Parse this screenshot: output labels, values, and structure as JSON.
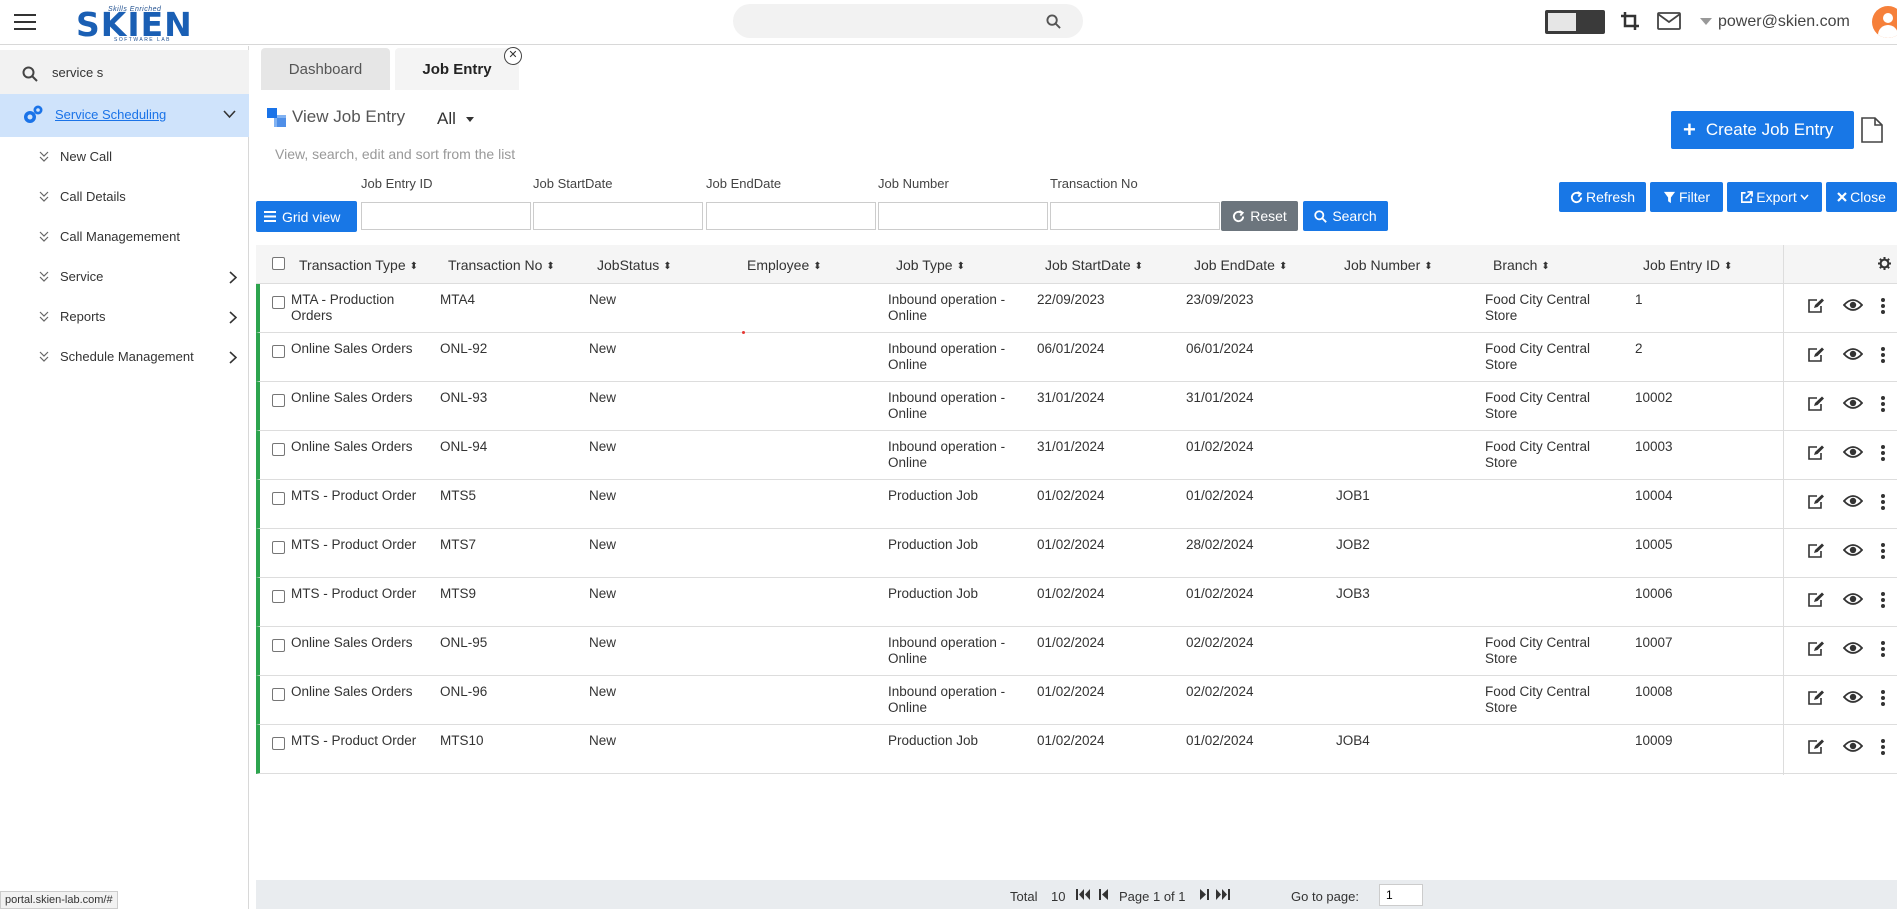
{
  "app": {
    "user_email": "power@skien.com",
    "status_url": "portal.skien-lab.com/#"
  },
  "logo": {
    "tagline": "Skills Enriched",
    "word": "SKIEN",
    "sub": "SOFTWARE LAB"
  },
  "sidebar": {
    "search_value": "service s",
    "active": "Service Scheduling",
    "items": [
      {
        "label": "New Call"
      },
      {
        "label": "Call Details"
      },
      {
        "label": "Call Managemement"
      },
      {
        "label": "Service"
      },
      {
        "label": "Reports"
      },
      {
        "label": "Schedule Management"
      }
    ]
  },
  "tabs": [
    {
      "label": "Dashboard"
    },
    {
      "label": "Job Entry"
    }
  ],
  "page": {
    "title": "View Job Entry",
    "filter": "All",
    "subtitle": "View, search, edit and sort from the list",
    "create_label": "Create Job Entry"
  },
  "filters": {
    "grid_view": "Grid view",
    "labels": [
      "Job Entry ID",
      "Job StartDate",
      "Job EndDate",
      "Job Number",
      "Transaction No"
    ],
    "reset": "Reset",
    "search": "Search"
  },
  "actions": {
    "refresh": "Refresh",
    "filter": "Filter",
    "export": "Export",
    "close": "Close"
  },
  "table": {
    "columns": [
      "Transaction Type",
      "Transaction No",
      "JobStatus",
      "Employee",
      "Job Type",
      "Job StartDate",
      "Job EndDate",
      "Job Number",
      "Branch",
      "Job Entry ID"
    ],
    "rows": [
      {
        "type": "MTA - Production Orders",
        "txn": "MTA4",
        "status": "New",
        "employee": "",
        "job_type": "Inbound operation - Online",
        "start": "22/09/2023",
        "end": "23/09/2023",
        "job_no": "",
        "branch": "Food City Central Store",
        "id": "1"
      },
      {
        "type": "Online Sales Orders",
        "txn": "ONL-92",
        "status": "New",
        "employee": "",
        "job_type": "Inbound operation - Online",
        "start": "06/01/2024",
        "end": "06/01/2024",
        "job_no": "",
        "branch": "Food City Central Store",
        "id": "2"
      },
      {
        "type": "Online Sales Orders",
        "txn": "ONL-93",
        "status": "New",
        "employee": "",
        "job_type": "Inbound operation - Online",
        "start": "31/01/2024",
        "end": "31/01/2024",
        "job_no": "",
        "branch": "Food City Central Store",
        "id": "10002"
      },
      {
        "type": "Online Sales Orders",
        "txn": "ONL-94",
        "status": "New",
        "employee": "",
        "job_type": "Inbound operation - Online",
        "start": "31/01/2024",
        "end": "01/02/2024",
        "job_no": "",
        "branch": "Food City Central Store",
        "id": "10003"
      },
      {
        "type": "MTS - Product Order",
        "txn": "MTS5",
        "status": "New",
        "employee": "",
        "job_type": "Production Job",
        "start": "01/02/2024",
        "end": "01/02/2024",
        "job_no": "JOB1",
        "branch": "",
        "id": "10004"
      },
      {
        "type": "MTS - Product Order",
        "txn": "MTS7",
        "status": "New",
        "employee": "",
        "job_type": "Production Job",
        "start": "01/02/2024",
        "end": "28/02/2024",
        "job_no": "JOB2",
        "branch": "",
        "id": "10005"
      },
      {
        "type": "MTS - Product Order",
        "txn": "MTS9",
        "status": "New",
        "employee": "",
        "job_type": "Production Job",
        "start": "01/02/2024",
        "end": "01/02/2024",
        "job_no": "JOB3",
        "branch": "",
        "id": "10006"
      },
      {
        "type": "Online Sales Orders",
        "txn": "ONL-95",
        "status": "New",
        "employee": "",
        "job_type": "Inbound operation - Online",
        "start": "01/02/2024",
        "end": "02/02/2024",
        "job_no": "",
        "branch": "Food City Central Store",
        "id": "10007"
      },
      {
        "type": "Online Sales Orders",
        "txn": "ONL-96",
        "status": "New",
        "employee": "",
        "job_type": "Inbound operation - Online",
        "start": "01/02/2024",
        "end": "02/02/2024",
        "job_no": "",
        "branch": "Food City Central Store",
        "id": "10008"
      },
      {
        "type": "MTS - Product Order",
        "txn": "MTS10",
        "status": "New",
        "employee": "",
        "job_type": "Production Job",
        "start": "01/02/2024",
        "end": "01/02/2024",
        "job_no": "JOB4",
        "branch": "",
        "id": "10009"
      }
    ]
  },
  "footer": {
    "total_label": "Total",
    "total": "10",
    "page_label": "Page 1 of 1",
    "goto_label": "Go to page:",
    "goto_value": "1"
  },
  "colors": {
    "primary": "#1877e6",
    "row_accent": "#2da44e",
    "active_bg": "#cfe3fb",
    "avatar": "#f6803a"
  }
}
